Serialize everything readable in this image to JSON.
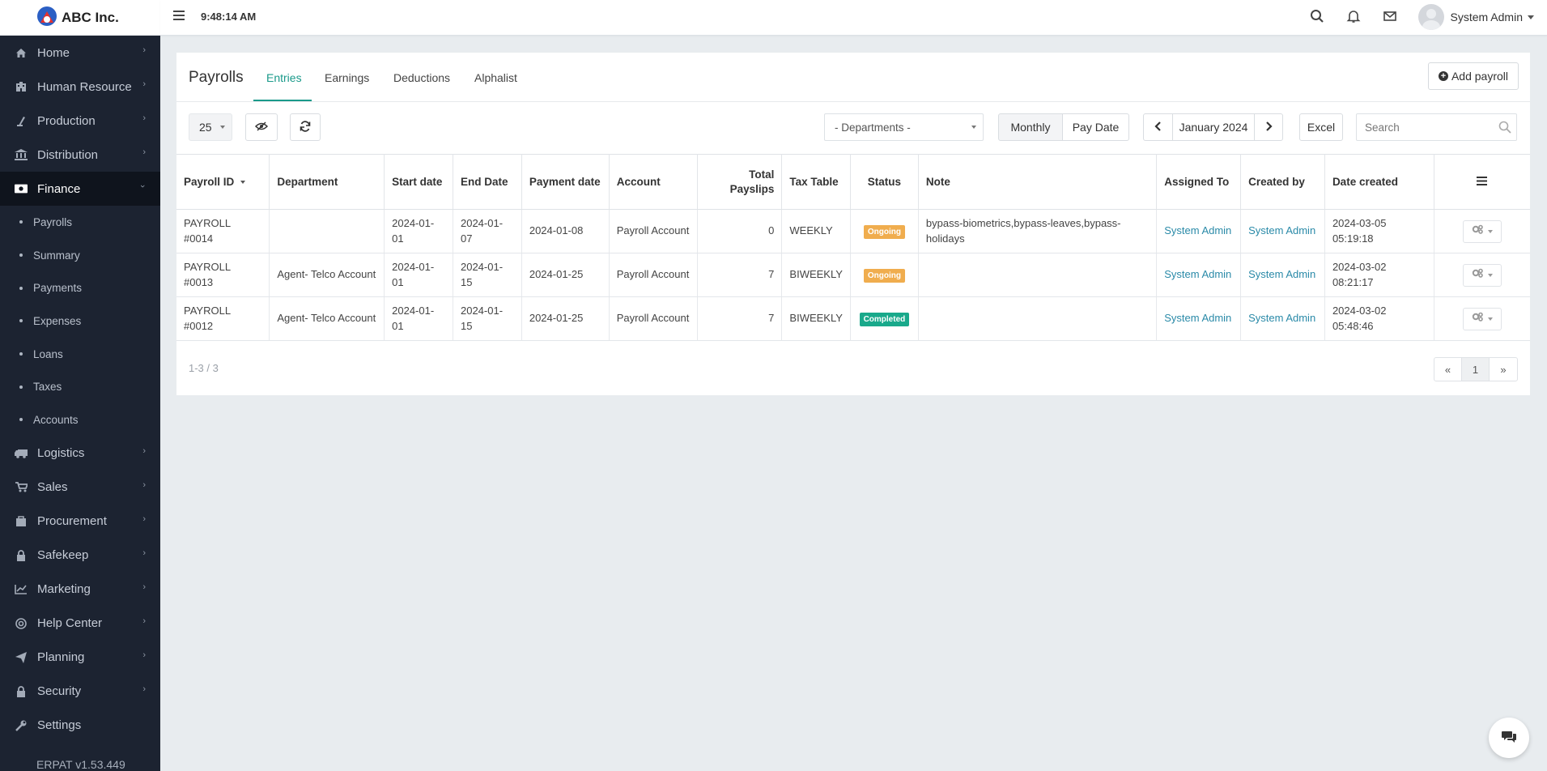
{
  "brand": {
    "name": "ABC Inc."
  },
  "sidebar": {
    "items": [
      {
        "label": "Home",
        "icon": "home-icon"
      },
      {
        "label": "Human Resource",
        "icon": "building-icon"
      },
      {
        "label": "Production",
        "icon": "flask-icon"
      },
      {
        "label": "Distribution",
        "icon": "bank-icon"
      },
      {
        "label": "Finance",
        "icon": "money-icon",
        "active": true
      }
    ],
    "finance_sub": [
      "Payrolls",
      "Summary",
      "Payments",
      "Expenses",
      "Loans",
      "Taxes",
      "Accounts"
    ],
    "items_after": [
      {
        "label": "Logistics",
        "icon": "truck-icon"
      },
      {
        "label": "Sales",
        "icon": "cart-icon"
      },
      {
        "label": "Procurement",
        "icon": "briefcase-icon"
      },
      {
        "label": "Safekeep",
        "icon": "lock-icon"
      },
      {
        "label": "Marketing",
        "icon": "chart-line-icon"
      },
      {
        "label": "Help Center",
        "icon": "lifebuoy-icon"
      },
      {
        "label": "Planning",
        "icon": "paper-plane-icon"
      },
      {
        "label": "Security",
        "icon": "lock-icon"
      },
      {
        "label": "Settings",
        "icon": "wrench-icon"
      }
    ],
    "version": "ERPAT v1.53.449"
  },
  "header": {
    "time": "9:48:14 AM",
    "user": "System Admin"
  },
  "page": {
    "title": "Payrolls",
    "tabs": [
      "Entries",
      "Earnings",
      "Deductions",
      "Alphalist"
    ],
    "active_tab": "Entries",
    "add_button": "Add payroll"
  },
  "toolbar": {
    "page_size": "25",
    "department_placeholder": "- Departments -",
    "view_monthly": "Monthly",
    "view_paydate": "Pay Date",
    "period": "January 2024",
    "excel": "Excel",
    "search_placeholder": "Search"
  },
  "table": {
    "columns": [
      "Payroll ID",
      "Department",
      "Start date",
      "End Date",
      "Payment date",
      "Account",
      "Total Payslips",
      "Tax Table",
      "Status",
      "Note",
      "Assigned To",
      "Created by",
      "Date created"
    ],
    "rows": [
      {
        "id": "PAYROLL #0014",
        "department": "",
        "start": "2024-01-01",
        "end": "2024-01-07",
        "payment": "2024-01-08",
        "account": "Payroll Account",
        "payslips": "0",
        "tax": "WEEKLY",
        "status": "Ongoing",
        "note": "bypass-biometrics,bypass-leaves,bypass-holidays",
        "assigned": "System Admin",
        "created_by": "System Admin",
        "created": "2024-03-05 05:19:18"
      },
      {
        "id": "PAYROLL #0013",
        "department": "Agent- Telco Account",
        "start": "2024-01-01",
        "end": "2024-01-15",
        "payment": "2024-01-25",
        "account": "Payroll Account",
        "payslips": "7",
        "tax": "BIWEEKLY",
        "status": "Ongoing",
        "note": "",
        "assigned": "System Admin",
        "created_by": "System Admin",
        "created": "2024-03-02 08:21:17"
      },
      {
        "id": "PAYROLL #0012",
        "department": "Agent- Telco Account",
        "start": "2024-01-01",
        "end": "2024-01-15",
        "payment": "2024-01-25",
        "account": "Payroll Account",
        "payslips": "7",
        "tax": "BIWEEKLY",
        "status": "Completed",
        "note": "",
        "assigned": "System Admin",
        "created_by": "System Admin",
        "created": "2024-03-02 05:48:46"
      }
    ]
  },
  "footer": {
    "range": "1-3 / 3",
    "pages": [
      "«",
      "1",
      "»"
    ]
  },
  "colors": {
    "sidebar_bg": "#1c2331",
    "accent": "#1a9a8a",
    "ongoing": "#f0ad4e",
    "completed": "#19a98b",
    "link": "#2a8aa8"
  }
}
